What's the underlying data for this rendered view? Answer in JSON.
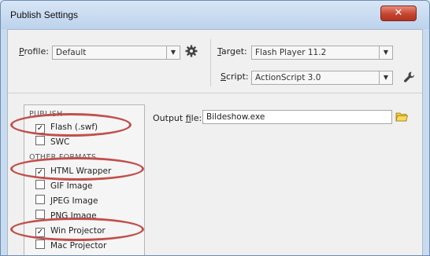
{
  "window": {
    "title": "Publish Settings",
    "close": "✕"
  },
  "profile": {
    "label_accel": "P",
    "label_rest": "rofile:",
    "value": "Default"
  },
  "target": {
    "label_accel": "T",
    "label_rest": "arget:",
    "value": "Flash Player 11.2"
  },
  "script": {
    "label_accel": "S",
    "label_rest": "cript:",
    "value": "ActionScript 3.0"
  },
  "formats": {
    "publish_header": "PUBLISH",
    "other_header": "OTHER FORMATS",
    "items": [
      {
        "label": "Flash (.swf)",
        "checked": true
      },
      {
        "label": "SWC",
        "checked": false
      },
      {
        "label": "HTML Wrapper",
        "checked": true
      },
      {
        "label": "GIF Image",
        "checked": false
      },
      {
        "label": "JPEG Image",
        "checked": false
      },
      {
        "label": "PNG Image",
        "checked": false
      },
      {
        "label": "Win Projector",
        "checked": true
      },
      {
        "label": "Mac Projector",
        "checked": false
      }
    ]
  },
  "output": {
    "label_pre": "Output ",
    "label_accel": "f",
    "label_rest": "ile:",
    "value": "Bildeshow.exe"
  },
  "colors": {
    "annotation": "#c0504d",
    "folder": "#e8b800"
  }
}
